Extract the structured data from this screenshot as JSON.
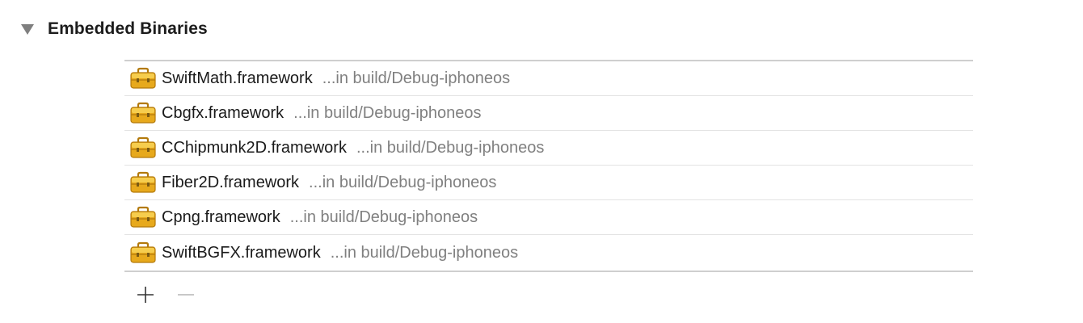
{
  "section": {
    "title": "Embedded Binaries",
    "expanded": true
  },
  "binaries": [
    {
      "name": "SwiftMath.framework",
      "location": "...in build/Debug-iphoneos",
      "icon": "framework-toolbox-icon"
    },
    {
      "name": "Cbgfx.framework",
      "location": "...in build/Debug-iphoneos",
      "icon": "framework-toolbox-icon"
    },
    {
      "name": "CChipmunk2D.framework",
      "location": "...in build/Debug-iphoneos",
      "icon": "framework-toolbox-icon"
    },
    {
      "name": "Fiber2D.framework",
      "location": "...in build/Debug-iphoneos",
      "icon": "framework-toolbox-icon"
    },
    {
      "name": "Cpng.framework",
      "location": "...in build/Debug-iphoneos",
      "icon": "framework-toolbox-icon"
    },
    {
      "name": "SwiftBGFX.framework",
      "location": "...in build/Debug-iphoneos",
      "icon": "framework-toolbox-icon"
    }
  ],
  "controls": {
    "add_icon": "plus-icon",
    "remove_icon": "minus-icon"
  },
  "colors": {
    "icon_gold": "#e7a91c",
    "icon_gold_light": "#f6cd4e",
    "icon_gold_dark": "#b37a0c",
    "secondary_text": "#808080",
    "separator": "#cfcfcf"
  }
}
